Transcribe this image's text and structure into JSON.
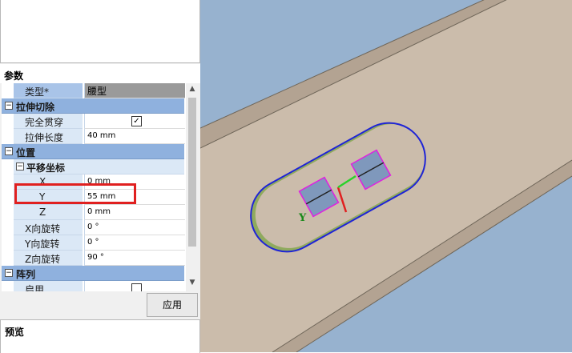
{
  "panel": {
    "params_title": "参数",
    "preview_title": "预览",
    "apply_label": "应用"
  },
  "type_row": {
    "label": "类型*",
    "value": "腰型"
  },
  "extrude_cut": {
    "title": "拉伸切除",
    "through_all_label": "完全贯穿",
    "through_all_checked": true,
    "length_label": "拉伸长度",
    "length_value": "40 mm"
  },
  "position": {
    "title": "位置",
    "translate_title": "平移坐标",
    "x_label": "X",
    "x_value": "0 mm",
    "y_label": "Y",
    "y_value": "55 mm",
    "z_label": "Z",
    "z_value": "0 mm",
    "x_rot_label": "X向旋转",
    "x_rot_value": "0 °",
    "y_rot_label": "Y向旋转",
    "y_rot_value": "0 °",
    "z_rot_label": "Z向旋转",
    "z_rot_value": "90 °"
  },
  "array": {
    "title": "阵列",
    "enable_label": "启用",
    "enable_checked": false
  },
  "viewport": {
    "axis_label": "Y",
    "background_color": "#97b2cf",
    "plate_color": "#cbbcab",
    "slot_outline_color": "#1f24d6",
    "highlight_color": "#e02020"
  }
}
